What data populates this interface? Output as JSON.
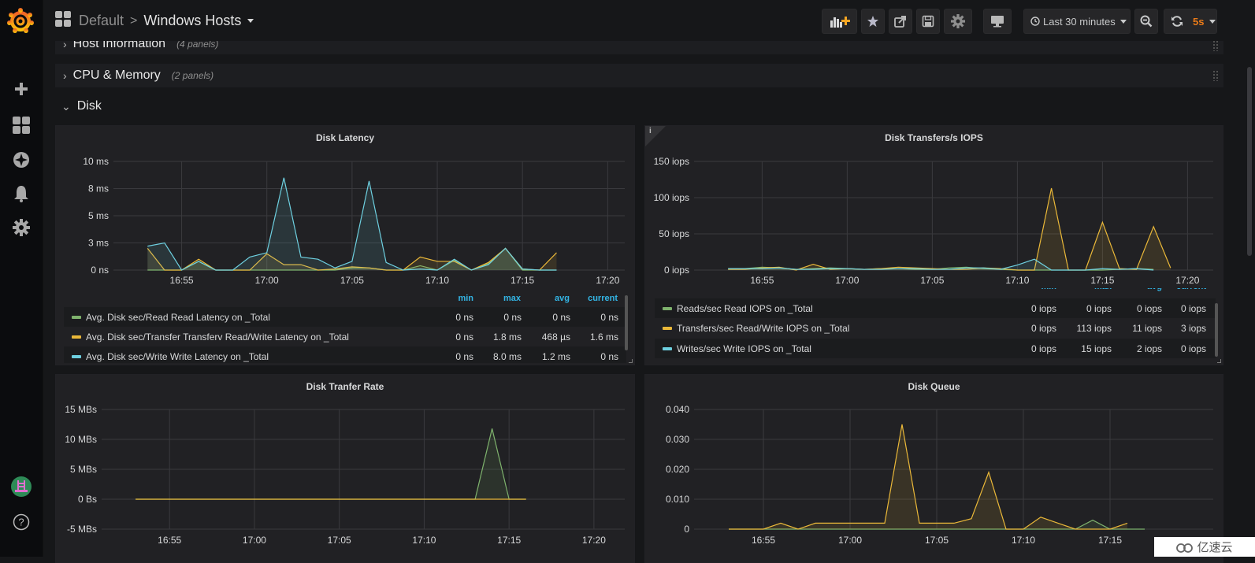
{
  "navbar": {
    "folder": "Default",
    "separator": ">",
    "dashboard_title": "Windows Hosts",
    "time_range": "Last 30 minutes",
    "refresh_interval": "5s"
  },
  "rows": [
    {
      "title": "Host Information",
      "count": "(4 panels)",
      "collapsed": true
    },
    {
      "title": "CPU & Memory",
      "count": "(2 panels)",
      "collapsed": true
    },
    {
      "title": "Disk",
      "count": "",
      "collapsed": false
    }
  ],
  "sidebar": {
    "items": [
      "create",
      "dashboards",
      "explore",
      "alerting",
      "configuration"
    ],
    "help": "?"
  },
  "colors": {
    "green": "#7eb26d",
    "yellow": "#eab839",
    "blue": "#6ed0e0",
    "legend_header": "#33b5e5",
    "refresh": "#eb7b18"
  },
  "panels": {
    "latency": {
      "title": "Disk Latency",
      "legend_headers": [
        "min",
        "max",
        "avg",
        "current"
      ],
      "legend": [
        {
          "name": "Avg. Disk sec/Read Read Latency on _Total",
          "color": "#7eb26d",
          "min": "0 ns",
          "max": "0 ns",
          "avg": "0 ns",
          "current": "0 ns"
        },
        {
          "name": "Avg. Disk sec/Transfer Transferv Read/Write Latency on _Total",
          "color": "#eab839",
          "min": "0 ns",
          "max": "1.8 ms",
          "avg": "468 µs",
          "current": "1.6 ms"
        },
        {
          "name": "Avg. Disk sec/Write Write Latency on _Total",
          "color": "#6ed0e0",
          "min": "0 ns",
          "max": "8.0 ms",
          "avg": "1.2 ms",
          "current": "0 ns"
        }
      ]
    },
    "iops": {
      "title": "Disk Transfers/s IOPS",
      "info": "i",
      "legend_headers": [
        "min",
        "max",
        "avg",
        "current"
      ],
      "legend": [
        {
          "name": "Reads/sec Read IOPS on _Total",
          "color": "#7eb26d",
          "min": "0 iops",
          "max": "0 iops",
          "avg": "0 iops",
          "current": "0 iops"
        },
        {
          "name": "Transfers/sec Read/Write IOPS on _Total",
          "color": "#eab839",
          "min": "0 iops",
          "max": "113 iops",
          "avg": "11 iops",
          "current": "3 iops"
        },
        {
          "name": "Writes/sec Write IOPS on _Total",
          "color": "#6ed0e0",
          "min": "0 iops",
          "max": "15 iops",
          "avg": "2 iops",
          "current": "0 iops"
        }
      ]
    },
    "rate": {
      "title": "Disk Tranfer Rate"
    },
    "queue": {
      "title": "Disk Queue"
    }
  },
  "watermark": "亿速云",
  "chart_data": [
    {
      "id": "latency",
      "type": "area",
      "title": "Disk Latency",
      "x_ticks": [
        "16:55",
        "17:00",
        "17:05",
        "17:10",
        "17:15",
        "17:20"
      ],
      "x_range": [
        "16:52",
        "17:22"
      ],
      "y_ticks": [
        "0 ns",
        "3 ms",
        "5 ms",
        "8 ms",
        "10 ms"
      ],
      "ylim": [
        0,
        10
      ],
      "x": [
        0,
        1,
        2,
        3,
        4,
        5,
        6,
        7,
        8,
        9,
        10,
        11,
        12,
        13,
        14,
        15,
        16,
        17,
        18,
        19,
        20,
        21,
        22,
        23,
        24
      ],
      "x_start": "16:53",
      "x_step_min": 1,
      "series": [
        {
          "name": "Read",
          "color": "#7eb26d",
          "values": [
            0,
            0,
            0,
            0.8,
            0,
            0,
            0,
            0,
            0,
            0,
            0,
            0,
            0.2,
            0.2,
            0,
            0,
            0.4,
            0,
            0.9,
            0,
            0.6,
            2.0,
            0,
            0,
            0
          ]
        },
        {
          "name": "Transfer",
          "color": "#eab839",
          "values": [
            2.0,
            0,
            0,
            1.0,
            0,
            0,
            0,
            1.5,
            0.5,
            0.5,
            0,
            0.1,
            0.3,
            0.2,
            0,
            0,
            1.2,
            0.8,
            0.8,
            0,
            0.7,
            2.0,
            0.1,
            0,
            1.6
          ]
        },
        {
          "name": "Write",
          "color": "#6ed0e0",
          "values": [
            2.2,
            2.5,
            0,
            0.8,
            0,
            0,
            1.2,
            1.6,
            8.5,
            1.2,
            1.0,
            0.2,
            0.8,
            8.2,
            0.7,
            0,
            0.1,
            0,
            1.0,
            0,
            0.5,
            2.0,
            0.1,
            0,
            0
          ]
        }
      ]
    },
    {
      "id": "iops",
      "type": "area",
      "title": "Disk Transfers/s IOPS",
      "x_ticks": [
        "16:55",
        "17:00",
        "17:05",
        "17:10",
        "17:15",
        "17:20"
      ],
      "y_ticks": [
        "0 iops",
        "50 iops",
        "100 iops",
        "150 iops"
      ],
      "ylim": [
        0,
        150
      ],
      "x_start": "16:53",
      "series": [
        {
          "name": "Reads/sec",
          "color": "#7eb26d",
          "values": [
            2,
            2,
            4,
            3,
            1,
            2,
            3,
            2,
            1,
            2,
            2,
            1,
            1,
            3,
            4,
            2,
            1,
            0,
            0,
            0,
            0,
            0,
            0,
            1,
            2,
            1
          ]
        },
        {
          "name": "Transfers/sec",
          "color": "#eab839",
          "values": [
            1,
            1,
            3,
            4,
            0,
            8,
            1,
            2,
            1,
            2,
            4,
            3,
            2,
            1,
            1,
            3,
            2,
            0,
            0,
            113,
            0,
            0,
            66,
            2,
            1,
            60,
            3
          ]
        },
        {
          "name": "Writes/sec",
          "color": "#6ed0e0",
          "values": [
            2,
            2,
            2,
            3,
            1,
            1,
            2,
            2,
            1,
            1,
            2,
            2,
            1,
            1,
            3,
            3,
            1,
            7,
            15,
            0,
            0,
            0,
            2,
            1,
            2,
            0
          ]
        }
      ]
    },
    {
      "id": "rate",
      "type": "area",
      "title": "Disk Tranfer Rate",
      "x_ticks": [
        "16:55",
        "17:00",
        "17:05",
        "17:10",
        "17:15",
        "17:20"
      ],
      "y_ticks": [
        "-5 MBs",
        "0 Bs",
        "5 MBs",
        "10 MBs",
        "15 MBs"
      ],
      "ylim": [
        -5,
        15
      ],
      "x_start": "16:53",
      "series": [
        {
          "name": "Read",
          "color": "#7eb26d",
          "values": [
            0,
            0,
            0,
            0,
            0,
            0,
            0,
            0,
            0,
            0,
            0,
            0,
            0,
            0,
            0,
            0,
            0,
            0,
            0,
            0,
            0,
            11.8,
            0,
            0
          ]
        },
        {
          "name": "Transfer",
          "color": "#eab839",
          "values": [
            0,
            0,
            0,
            0,
            0,
            0,
            0,
            0,
            0,
            0,
            0,
            0,
            0,
            0,
            0,
            0,
            0,
            0,
            0,
            0,
            0,
            0,
            0,
            0
          ]
        }
      ]
    },
    {
      "id": "queue",
      "type": "area",
      "title": "Disk Queue",
      "x_ticks": [
        "16:55",
        "17:00",
        "17:05",
        "17:10",
        "17:15"
      ],
      "y_ticks": [
        "0",
        "0.010",
        "0.020",
        "0.030",
        "0.040"
      ],
      "ylim": [
        0,
        0.04
      ],
      "x_start": "16:53",
      "series": [
        {
          "name": "Read",
          "color": "#7eb26d",
          "values": [
            0,
            0,
            0,
            0,
            0,
            0,
            0,
            0,
            0,
            0,
            0,
            0,
            0,
            0,
            0,
            0,
            0,
            0,
            0,
            0,
            0,
            0.003,
            0,
            0,
            0
          ]
        },
        {
          "name": "Queue",
          "color": "#eab839",
          "values": [
            0,
            0,
            0,
            0.002,
            0,
            0.002,
            0.002,
            0.002,
            0.002,
            0.002,
            0.035,
            0.002,
            0.002,
            0.002,
            0.0035,
            0.019,
            0,
            0,
            0.004,
            0.002,
            0,
            0,
            0,
            0.002
          ]
        }
      ]
    }
  ]
}
